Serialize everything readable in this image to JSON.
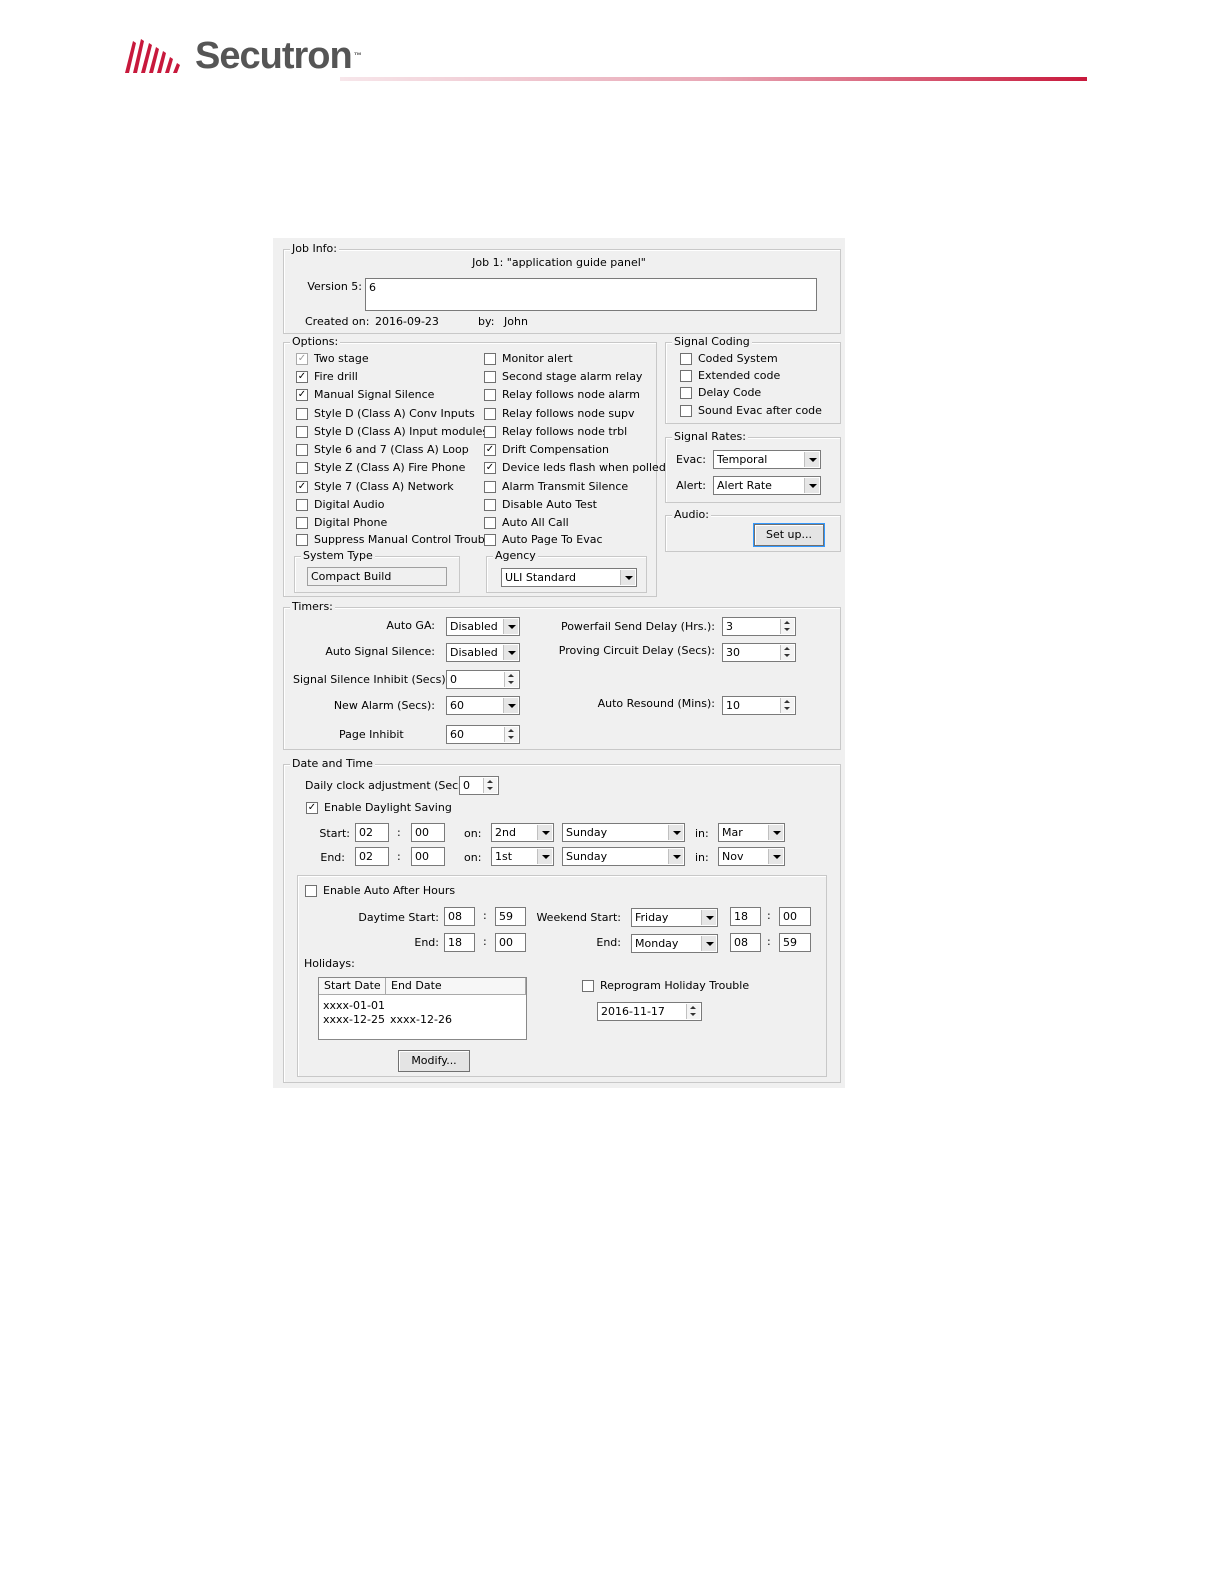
{
  "brand": {
    "name": "Secutron",
    "tm": "™"
  },
  "job_info": {
    "legend": "Job Info:",
    "job_title": "Job 1:  \"application guide panel\"",
    "version_label": "Version 5:",
    "version_value": "6",
    "created_label": "Created on:",
    "created_value": "2016-09-23",
    "by_label": "by:",
    "by_value": "John"
  },
  "options": {
    "legend": "Options:",
    "left": [
      {
        "label": "Two stage",
        "checked": true,
        "disabled": true
      },
      {
        "label": "Fire drill",
        "checked": true
      },
      {
        "label": "Manual Signal Silence",
        "checked": true
      },
      {
        "label": "Style D (Class A) Conv Inputs",
        "checked": false
      },
      {
        "label": "Style D (Class A) Input modules",
        "checked": false
      },
      {
        "label": "Style 6 and 7 (Class A) Loop",
        "checked": false
      },
      {
        "label": "Style Z (Class A) Fire Phone",
        "checked": false
      },
      {
        "label": "Style 7 (Class A) Network",
        "checked": true
      },
      {
        "label": "Digital Audio",
        "checked": false
      },
      {
        "label": "Digital Phone",
        "checked": false
      },
      {
        "label": "Suppress Manual Control Trouble",
        "checked": false
      }
    ],
    "right": [
      {
        "label": "Monitor alert",
        "checked": false
      },
      {
        "label": "Second stage alarm relay",
        "checked": false
      },
      {
        "label": "Relay follows node alarm",
        "checked": false
      },
      {
        "label": "Relay follows node supv",
        "checked": false
      },
      {
        "label": "Relay follows node trbl",
        "checked": false
      },
      {
        "label": "Drift Compensation",
        "checked": true
      },
      {
        "label": "Device leds flash when polled",
        "checked": true
      },
      {
        "label": "Alarm Transmit Silence",
        "checked": false
      },
      {
        "label": "Disable Auto Test",
        "checked": false
      },
      {
        "label": "Auto All Call",
        "checked": false
      },
      {
        "label": "Auto Page To Evac",
        "checked": false
      }
    ],
    "system_type_legend": "System Type",
    "system_type_value": "Compact Build",
    "agency_legend": "Agency",
    "agency_value": "ULI Standard"
  },
  "signal_coding": {
    "legend": "Signal Coding",
    "items": [
      {
        "label": "Coded System",
        "checked": false
      },
      {
        "label": "Extended code",
        "checked": false
      },
      {
        "label": "Delay Code",
        "checked": false
      },
      {
        "label": "Sound Evac after code",
        "checked": false
      }
    ]
  },
  "signal_rates": {
    "legend": "Signal Rates:",
    "evac_label": "Evac:",
    "evac_value": "Temporal",
    "alert_label": "Alert:",
    "alert_value": "Alert Rate"
  },
  "audio": {
    "legend": "Audio:",
    "setup_label": "Set up..."
  },
  "timers": {
    "legend": "Timers:",
    "auto_ga_label": "Auto GA:",
    "auto_ga_value": "Disabled",
    "auto_signal_silence_label": "Auto Signal Silence:",
    "auto_signal_silence_value": "Disabled",
    "signal_silence_inhibit_label": "Signal Silence Inhibit (Secs):",
    "signal_silence_inhibit_value": "0",
    "new_alarm_label": "New Alarm (Secs):",
    "new_alarm_value": "60",
    "page_inhibit_label": "Page Inhibit",
    "page_inhibit_value": "60",
    "powerfail_label": "Powerfail Send Delay (Hrs.):",
    "powerfail_value": "3",
    "proving_label": "Proving Circuit Delay (Secs):",
    "proving_value": "30",
    "auto_resound_label": "Auto Resound (Mins):",
    "auto_resound_value": "10"
  },
  "date_time": {
    "legend": "Date and Time",
    "daily_clock_label": "Daily clock adjustment (Secs):",
    "daily_clock_value": "0",
    "daylight_label": "Enable Daylight Saving",
    "daylight_checked": true,
    "start_label": "Start:",
    "end_label": "End:",
    "colon": ":",
    "on_label": "on:",
    "in_label": "in:",
    "start": {
      "hh": "02",
      "mm": "00",
      "week": "2nd",
      "day": "Sunday",
      "month": "Mar"
    },
    "end": {
      "hh": "02",
      "mm": "00",
      "week": "1st",
      "day": "Sunday",
      "month": "Nov"
    }
  },
  "after_hours": {
    "enable_label": "Enable Auto After Hours",
    "enable_checked": false,
    "daytime_start_label": "Daytime Start:",
    "daytime_start_hh": "08",
    "daytime_start_mm": "59",
    "daytime_end_label": "End:",
    "daytime_end_hh": "18",
    "daytime_end_mm": "00",
    "weekend_start_label": "Weekend Start:",
    "weekend_start_day": "Friday",
    "weekend_start_hh": "18",
    "weekend_start_mm": "00",
    "weekend_end_label": "End:",
    "weekend_end_day": "Monday",
    "weekend_end_hh": "08",
    "weekend_end_mm": "59",
    "holidays_label": "Holidays:",
    "holidays_columns": [
      "Start Date",
      "End Date"
    ],
    "holidays_rows": [
      {
        "start": "xxxx-01-01",
        "end": ""
      },
      {
        "start": "xxxx-12-25",
        "end": "xxxx-12-26"
      }
    ],
    "modify_label": "Modify...",
    "reprogram_label": "Reprogram Holiday Trouble",
    "reprogram_checked": false,
    "reprogram_date": "2016-11-17"
  }
}
